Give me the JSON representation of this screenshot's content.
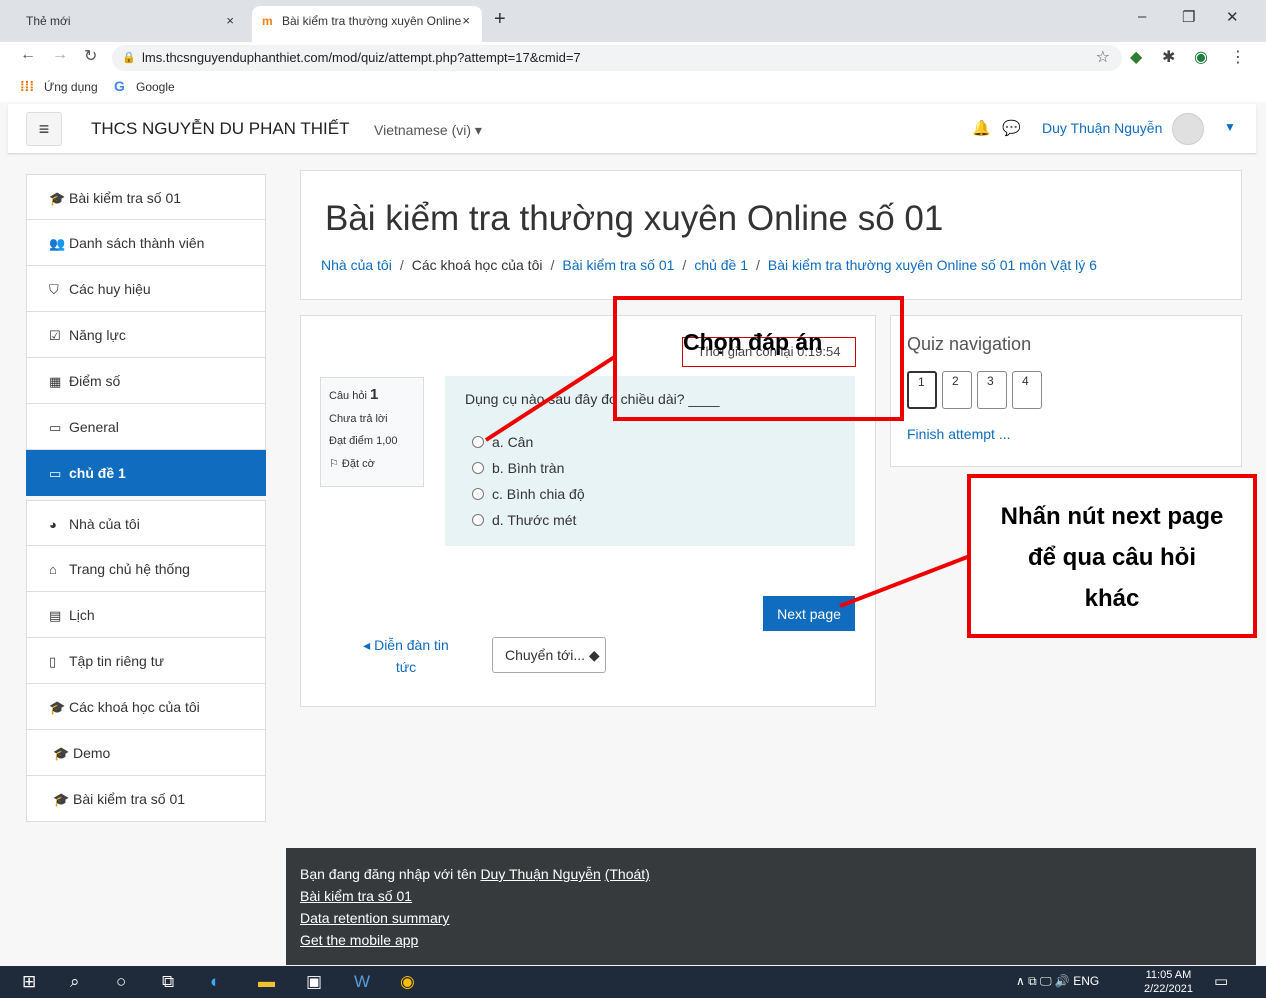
{
  "browser": {
    "tabs": [
      {
        "title": "Thẻ mới",
        "close": "×"
      },
      {
        "title": "Bài kiểm tra thường xuyên Online",
        "close": "×",
        "favicon": "m"
      }
    ],
    "new_tab": "+",
    "window_controls": {
      "minimize": "–",
      "restore": "❐",
      "close": "✕"
    },
    "url": "lms.thcsnguyenduphanthiet.com/mod/quiz/attempt.php?attempt=17&cmid=7",
    "bookmarks": [
      {
        "label": "Ứng dụng"
      },
      {
        "label": "Google"
      }
    ]
  },
  "navbar": {
    "site_name": "THCS NGUYỄN DU PHAN THIẾT",
    "language": "Vietnamese (vi) ▾",
    "user_name": "Duy Thuận Nguyễn"
  },
  "sidebar": {
    "items": [
      {
        "label": "Bài kiểm tra số 01",
        "icon": "graduation-cap-icon",
        "glyph": "🎓"
      },
      {
        "label": "Danh sách thành viên",
        "icon": "users-icon",
        "glyph": "👥"
      },
      {
        "label": "Các huy hiệu",
        "icon": "shield-icon",
        "glyph": "⛉"
      },
      {
        "label": "Năng lực",
        "icon": "checkbox-icon",
        "glyph": "☑"
      },
      {
        "label": "Điểm số",
        "icon": "table-icon",
        "glyph": "▦"
      },
      {
        "label": "General",
        "icon": "folder-icon",
        "glyph": "▭"
      },
      {
        "label": "chủ đề 1",
        "icon": "folder-icon",
        "glyph": "▭"
      },
      {
        "label": "Nhà của tôi",
        "icon": "dashboard-icon",
        "glyph": "◕"
      },
      {
        "label": "Trang chủ hệ thống",
        "icon": "home-icon",
        "glyph": "⌂"
      },
      {
        "label": "Lịch",
        "icon": "calendar-icon",
        "glyph": "▤"
      },
      {
        "label": "Tập tin riêng tư",
        "icon": "file-icon",
        "glyph": "▯"
      },
      {
        "label": "Các khoá học của tôi",
        "icon": "graduation-cap-icon",
        "glyph": "🎓"
      },
      {
        "label": "Demo",
        "icon": "graduation-cap-icon",
        "glyph": "🎓"
      },
      {
        "label": "Bài kiểm tra số 01",
        "icon": "graduation-cap-icon",
        "glyph": "🎓"
      }
    ]
  },
  "header": {
    "title": "Bài kiểm tra thường xuyên Online số 01",
    "breadcrumb": [
      "Nhà của tôi",
      "Các khoá học của tôi",
      "Bài kiểm tra số 01",
      "chủ đề 1",
      "Bài kiểm tra thường xuyên Online số 01 môn Vật lý 6"
    ],
    "separator": "/"
  },
  "quiz": {
    "timer": "Thời gian còn lại 0:19:54",
    "question_label": "Câu hỏi",
    "question_number": "1",
    "status": "Chưa trả lời",
    "points": "Đạt điểm 1,00",
    "flag": "Đặt cờ",
    "question_text": "Dụng cụ nào sau đây đo chiều dài? ____",
    "options": [
      "a. Cân",
      "b. Bình tràn",
      "c. Bình chia độ",
      "d. Thước mét"
    ],
    "next_button": "Next page",
    "forum_link": "◂ Diễn đàn tin tức",
    "jump_select": "Chuyển tới... ◆"
  },
  "quiz_nav": {
    "title": "Quiz navigation",
    "questions": [
      "1",
      "2",
      "3",
      "4"
    ],
    "finish": "Finish attempt ..."
  },
  "footer": {
    "login_prefix": "Bạn đang đăng nhập với tên ",
    "user_link": "Duy Thuận Nguyễn",
    "logout": "(Thoát)",
    "links": [
      "Bài kiểm tra số 01",
      "Data retention summary",
      "Get the mobile app"
    ]
  },
  "annotations": {
    "choose_answer": "Chọn đáp án",
    "next_hint": [
      "Nhấn nút next page",
      "để qua câu  hỏi",
      "khác"
    ],
    "color": "#e00000"
  },
  "taskbar": {
    "tray": "∧ ⧉ 🖵 🔊 ENG",
    "time": "11:05 AM",
    "date": "2/22/2021"
  }
}
